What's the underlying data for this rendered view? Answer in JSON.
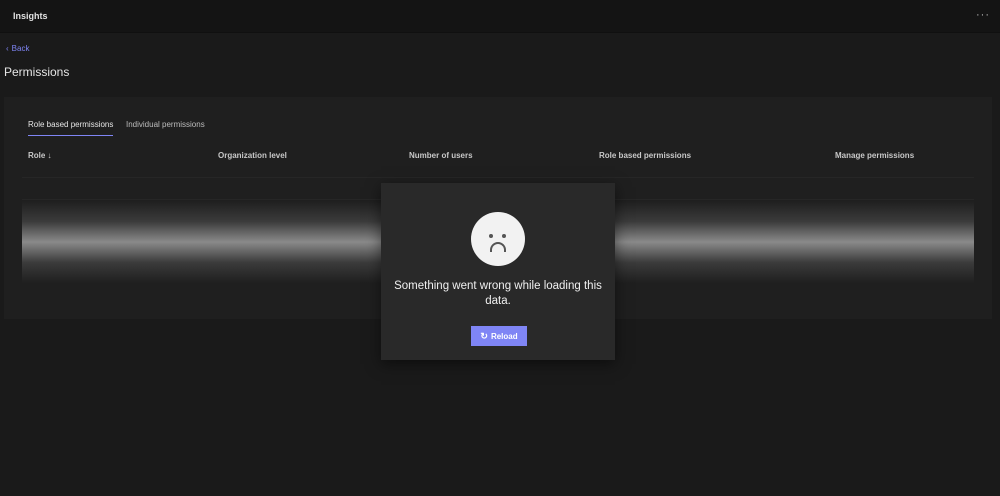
{
  "app": {
    "title": "Insights",
    "more_label": "···"
  },
  "nav": {
    "back_label": "Back",
    "back_icon": "‹"
  },
  "page": {
    "title": "Permissions"
  },
  "tabs": [
    {
      "label": "Role based permissions",
      "active": true
    },
    {
      "label": "Individual permissions",
      "active": false
    }
  ],
  "table": {
    "columns": [
      "Role ↓",
      "Organization level",
      "Number of users",
      "Role based permissions",
      "Manage permissions"
    ]
  },
  "error": {
    "message": "Something went wrong while loading this data.",
    "reload_label": "Reload",
    "reload_icon": "↻"
  },
  "colors": {
    "accent": "#7f85f5",
    "background": "#1a1a1a",
    "panel": "#1f1f1f",
    "card": "#292929"
  }
}
